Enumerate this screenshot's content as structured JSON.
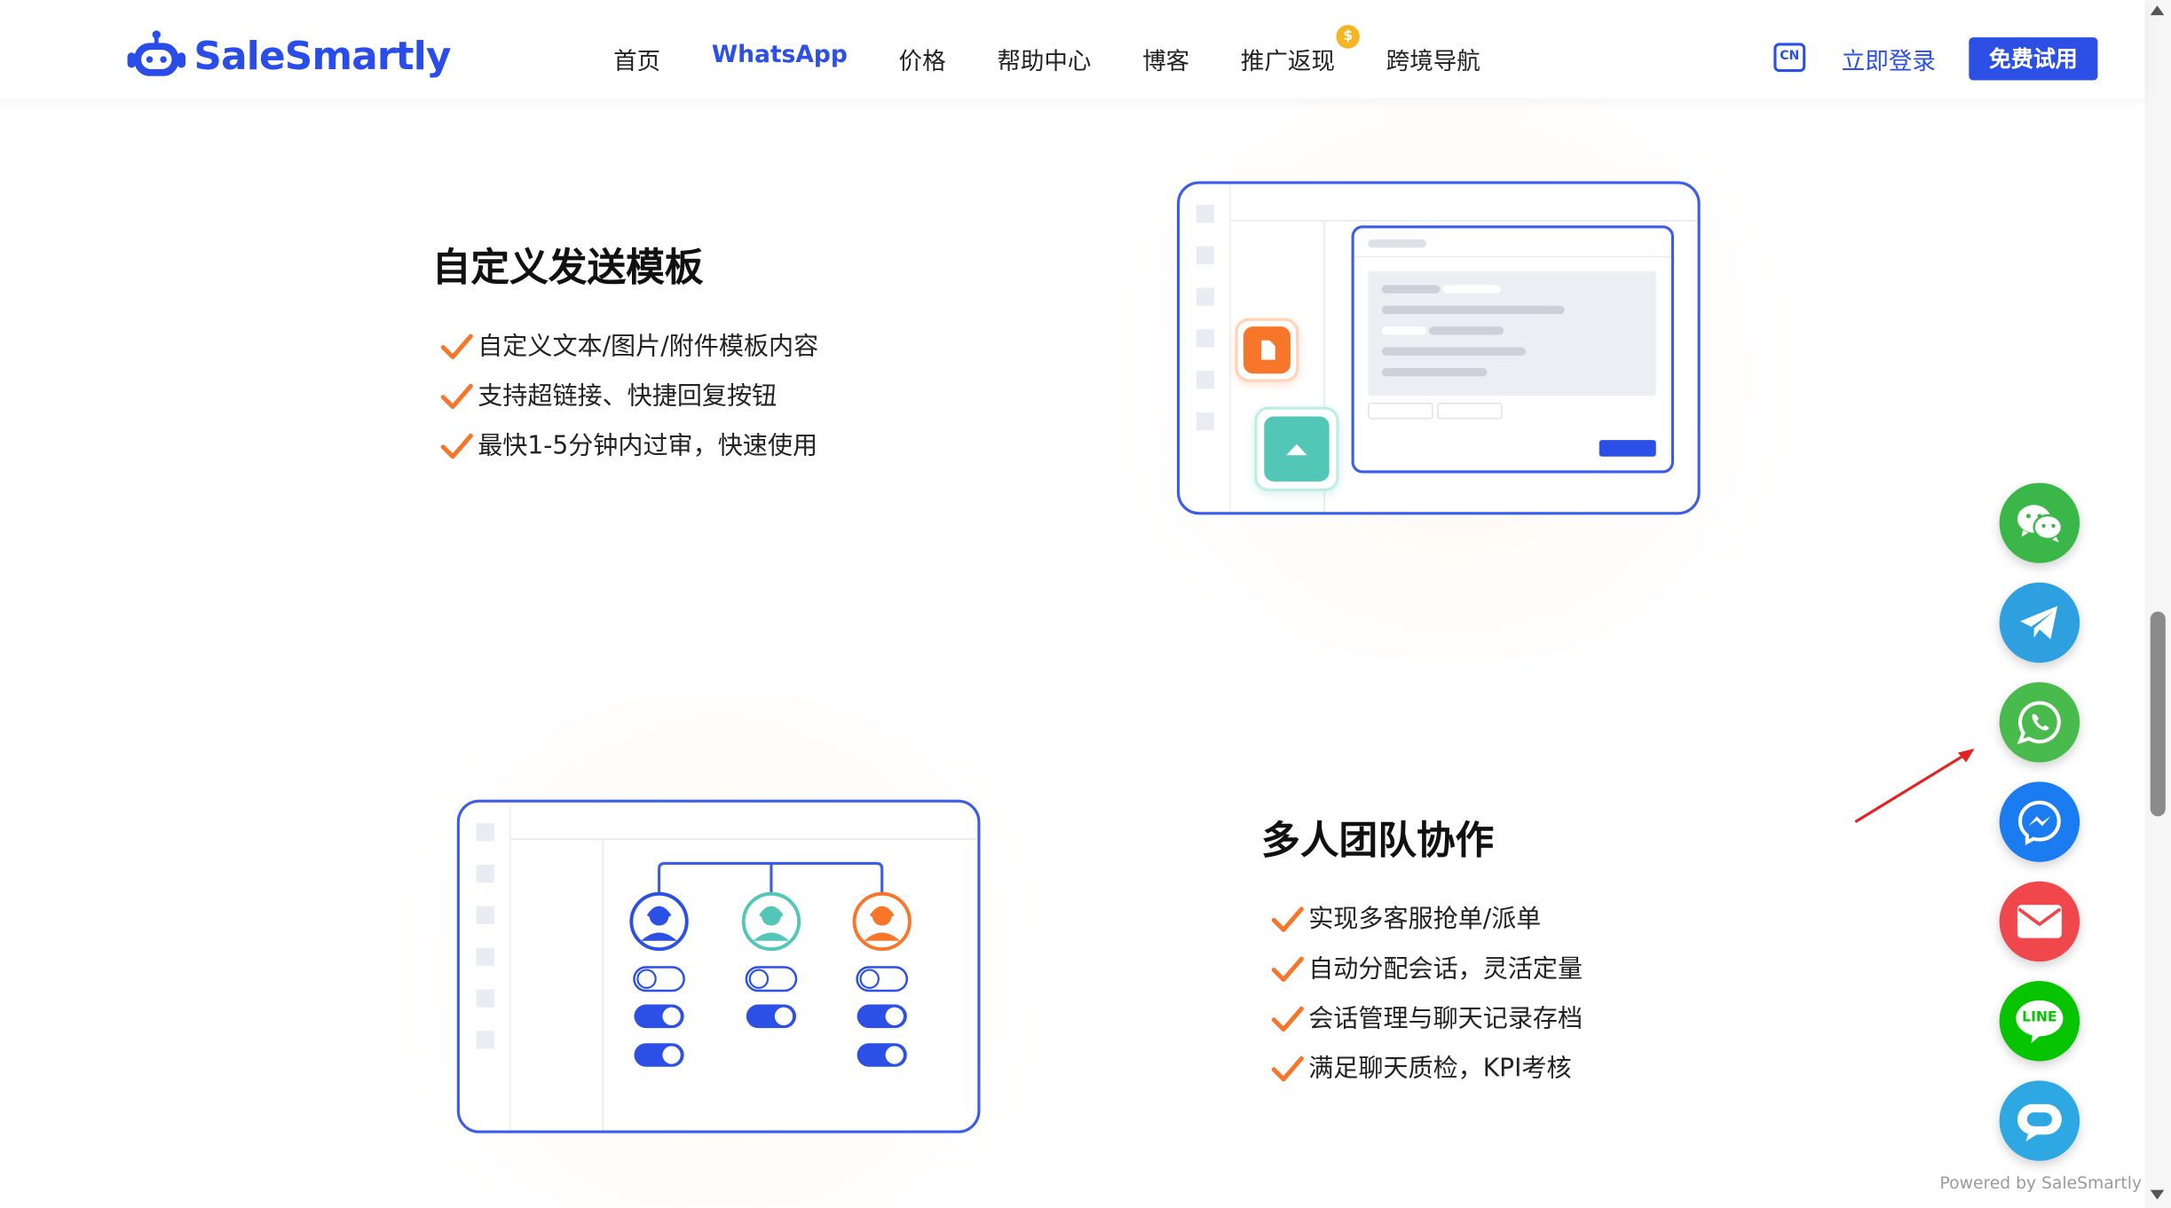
{
  "brand": {
    "name": "SaleSmartly",
    "color": "#2c4fe6"
  },
  "nav": {
    "items": [
      "首页",
      "WhatsApp",
      "价格",
      "帮助中心",
      "博客",
      "推广返现",
      "跨境导航"
    ],
    "active": "WhatsApp",
    "promo_badge_icon": "coin-icon"
  },
  "header": {
    "lang_label": "CN",
    "login_label": "立即登录",
    "trial_label": "免费试用"
  },
  "section1": {
    "title": "自定义发送模板",
    "points": [
      "自定义文本/图片/附件模板内容",
      "支持超链接、快捷回复按钮",
      "最快1-5分钟内过审，快速使用"
    ]
  },
  "section2": {
    "title": "多人团队协作",
    "points": [
      "实现多客服抢单/派单",
      "自动分配会话，灵活定量",
      "会话管理与聊天记录存档",
      "满足聊天质检，KPI考核"
    ]
  },
  "floating_contacts": [
    {
      "name": "wechat",
      "color": "#3bb74a"
    },
    {
      "name": "telegram",
      "color": "#2ea0e0"
    },
    {
      "name": "whatsapp",
      "color": "#48bb4c"
    },
    {
      "name": "messenger",
      "color": "#1a7cf0"
    },
    {
      "name": "email",
      "color": "#f0474d"
    },
    {
      "name": "line",
      "color": "#06c400",
      "label": "LINE"
    },
    {
      "name": "livechat",
      "color": "#2ea8e3"
    }
  ],
  "powered_by": "Powered by SaleSmartly",
  "colors": {
    "accent_orange": "#f7762a",
    "accent_teal": "#52c6b7",
    "frame_blue": "#3b5de7"
  }
}
